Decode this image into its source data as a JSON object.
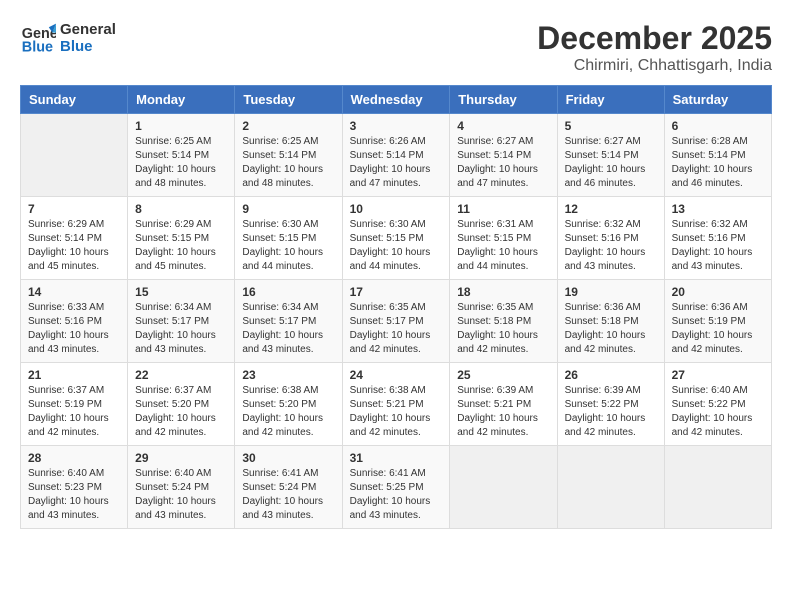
{
  "logo": {
    "line1": "General",
    "line2": "Blue"
  },
  "title": {
    "month": "December 2025",
    "location": "Chirmiri, Chhattisgarh, India"
  },
  "headers": [
    "Sunday",
    "Monday",
    "Tuesday",
    "Wednesday",
    "Thursday",
    "Friday",
    "Saturday"
  ],
  "weeks": [
    [
      {
        "day": "",
        "sunrise": "",
        "sunset": "",
        "daylight": ""
      },
      {
        "day": "1",
        "sunrise": "Sunrise: 6:25 AM",
        "sunset": "Sunset: 5:14 PM",
        "daylight": "Daylight: 10 hours and 48 minutes."
      },
      {
        "day": "2",
        "sunrise": "Sunrise: 6:25 AM",
        "sunset": "Sunset: 5:14 PM",
        "daylight": "Daylight: 10 hours and 48 minutes."
      },
      {
        "day": "3",
        "sunrise": "Sunrise: 6:26 AM",
        "sunset": "Sunset: 5:14 PM",
        "daylight": "Daylight: 10 hours and 47 minutes."
      },
      {
        "day": "4",
        "sunrise": "Sunrise: 6:27 AM",
        "sunset": "Sunset: 5:14 PM",
        "daylight": "Daylight: 10 hours and 47 minutes."
      },
      {
        "day": "5",
        "sunrise": "Sunrise: 6:27 AM",
        "sunset": "Sunset: 5:14 PM",
        "daylight": "Daylight: 10 hours and 46 minutes."
      },
      {
        "day": "6",
        "sunrise": "Sunrise: 6:28 AM",
        "sunset": "Sunset: 5:14 PM",
        "daylight": "Daylight: 10 hours and 46 minutes."
      }
    ],
    [
      {
        "day": "7",
        "sunrise": "Sunrise: 6:29 AM",
        "sunset": "Sunset: 5:14 PM",
        "daylight": "Daylight: 10 hours and 45 minutes."
      },
      {
        "day": "8",
        "sunrise": "Sunrise: 6:29 AM",
        "sunset": "Sunset: 5:15 PM",
        "daylight": "Daylight: 10 hours and 45 minutes."
      },
      {
        "day": "9",
        "sunrise": "Sunrise: 6:30 AM",
        "sunset": "Sunset: 5:15 PM",
        "daylight": "Daylight: 10 hours and 44 minutes."
      },
      {
        "day": "10",
        "sunrise": "Sunrise: 6:30 AM",
        "sunset": "Sunset: 5:15 PM",
        "daylight": "Daylight: 10 hours and 44 minutes."
      },
      {
        "day": "11",
        "sunrise": "Sunrise: 6:31 AM",
        "sunset": "Sunset: 5:15 PM",
        "daylight": "Daylight: 10 hours and 44 minutes."
      },
      {
        "day": "12",
        "sunrise": "Sunrise: 6:32 AM",
        "sunset": "Sunset: 5:16 PM",
        "daylight": "Daylight: 10 hours and 43 minutes."
      },
      {
        "day": "13",
        "sunrise": "Sunrise: 6:32 AM",
        "sunset": "Sunset: 5:16 PM",
        "daylight": "Daylight: 10 hours and 43 minutes."
      }
    ],
    [
      {
        "day": "14",
        "sunrise": "Sunrise: 6:33 AM",
        "sunset": "Sunset: 5:16 PM",
        "daylight": "Daylight: 10 hours and 43 minutes."
      },
      {
        "day": "15",
        "sunrise": "Sunrise: 6:34 AM",
        "sunset": "Sunset: 5:17 PM",
        "daylight": "Daylight: 10 hours and 43 minutes."
      },
      {
        "day": "16",
        "sunrise": "Sunrise: 6:34 AM",
        "sunset": "Sunset: 5:17 PM",
        "daylight": "Daylight: 10 hours and 43 minutes."
      },
      {
        "day": "17",
        "sunrise": "Sunrise: 6:35 AM",
        "sunset": "Sunset: 5:17 PM",
        "daylight": "Daylight: 10 hours and 42 minutes."
      },
      {
        "day": "18",
        "sunrise": "Sunrise: 6:35 AM",
        "sunset": "Sunset: 5:18 PM",
        "daylight": "Daylight: 10 hours and 42 minutes."
      },
      {
        "day": "19",
        "sunrise": "Sunrise: 6:36 AM",
        "sunset": "Sunset: 5:18 PM",
        "daylight": "Daylight: 10 hours and 42 minutes."
      },
      {
        "day": "20",
        "sunrise": "Sunrise: 6:36 AM",
        "sunset": "Sunset: 5:19 PM",
        "daylight": "Daylight: 10 hours and 42 minutes."
      }
    ],
    [
      {
        "day": "21",
        "sunrise": "Sunrise: 6:37 AM",
        "sunset": "Sunset: 5:19 PM",
        "daylight": "Daylight: 10 hours and 42 minutes."
      },
      {
        "day": "22",
        "sunrise": "Sunrise: 6:37 AM",
        "sunset": "Sunset: 5:20 PM",
        "daylight": "Daylight: 10 hours and 42 minutes."
      },
      {
        "day": "23",
        "sunrise": "Sunrise: 6:38 AM",
        "sunset": "Sunset: 5:20 PM",
        "daylight": "Daylight: 10 hours and 42 minutes."
      },
      {
        "day": "24",
        "sunrise": "Sunrise: 6:38 AM",
        "sunset": "Sunset: 5:21 PM",
        "daylight": "Daylight: 10 hours and 42 minutes."
      },
      {
        "day": "25",
        "sunrise": "Sunrise: 6:39 AM",
        "sunset": "Sunset: 5:21 PM",
        "daylight": "Daylight: 10 hours and 42 minutes."
      },
      {
        "day": "26",
        "sunrise": "Sunrise: 6:39 AM",
        "sunset": "Sunset: 5:22 PM",
        "daylight": "Daylight: 10 hours and 42 minutes."
      },
      {
        "day": "27",
        "sunrise": "Sunrise: 6:40 AM",
        "sunset": "Sunset: 5:22 PM",
        "daylight": "Daylight: 10 hours and 42 minutes."
      }
    ],
    [
      {
        "day": "28",
        "sunrise": "Sunrise: 6:40 AM",
        "sunset": "Sunset: 5:23 PM",
        "daylight": "Daylight: 10 hours and 43 minutes."
      },
      {
        "day": "29",
        "sunrise": "Sunrise: 6:40 AM",
        "sunset": "Sunset: 5:24 PM",
        "daylight": "Daylight: 10 hours and 43 minutes."
      },
      {
        "day": "30",
        "sunrise": "Sunrise: 6:41 AM",
        "sunset": "Sunset: 5:24 PM",
        "daylight": "Daylight: 10 hours and 43 minutes."
      },
      {
        "day": "31",
        "sunrise": "Sunrise: 6:41 AM",
        "sunset": "Sunset: 5:25 PM",
        "daylight": "Daylight: 10 hours and 43 minutes."
      },
      {
        "day": "",
        "sunrise": "",
        "sunset": "",
        "daylight": ""
      },
      {
        "day": "",
        "sunrise": "",
        "sunset": "",
        "daylight": ""
      },
      {
        "day": "",
        "sunrise": "",
        "sunset": "",
        "daylight": ""
      }
    ]
  ]
}
